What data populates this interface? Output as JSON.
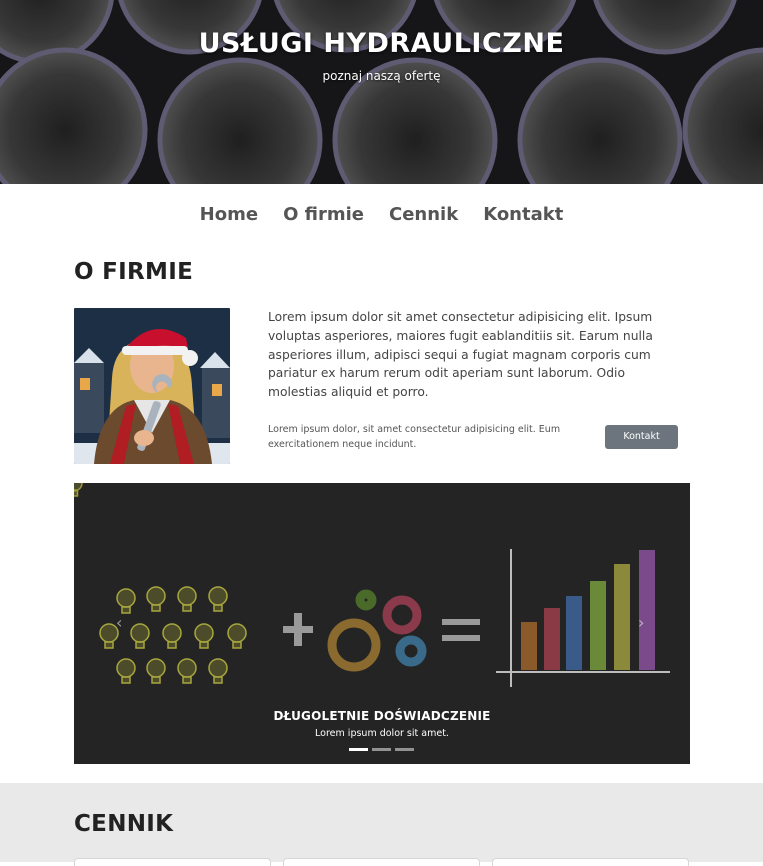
{
  "hero": {
    "title": "USŁUGI HYDRAULICZNE",
    "subtitle": "poznaj naszą ofertę"
  },
  "nav": {
    "items": [
      "Home",
      "O firmie",
      "Cennik",
      "Kontakt"
    ]
  },
  "about": {
    "title": "O FIRMIE",
    "text": "Lorem ipsum dolor sit amet consectetur adipisicing elit. Ipsum voluptas asperiores, maiores fugit eablanditiis sit. Earum nulla asperiores illum, adipisci sequi a fugiat magnam corporis cum pariatur ex harum rerum odit aperiam sunt laborum. Odio molestias aliquid et porro.",
    "small_text": "Lorem ipsum dolor, sit amet consectetur adipisicing elit. Eum exercitationem neque incidunt.",
    "button_label": "Kontakt"
  },
  "carousel": {
    "caption_title": "DŁUGOLETNIE DOŚWIADCZENIE",
    "caption_text": "Lorem ipsum dolor sit amet.",
    "prev_icon": "chevron-left-icon",
    "next_icon": "chevron-right-icon",
    "slide_count": 3,
    "active_slide": 1
  },
  "pricing": {
    "title": "CENNIK"
  },
  "colors": {
    "button_bg": "#6c757d",
    "pricing_bg": "#e9e9ea",
    "nav_text": "#555555"
  }
}
